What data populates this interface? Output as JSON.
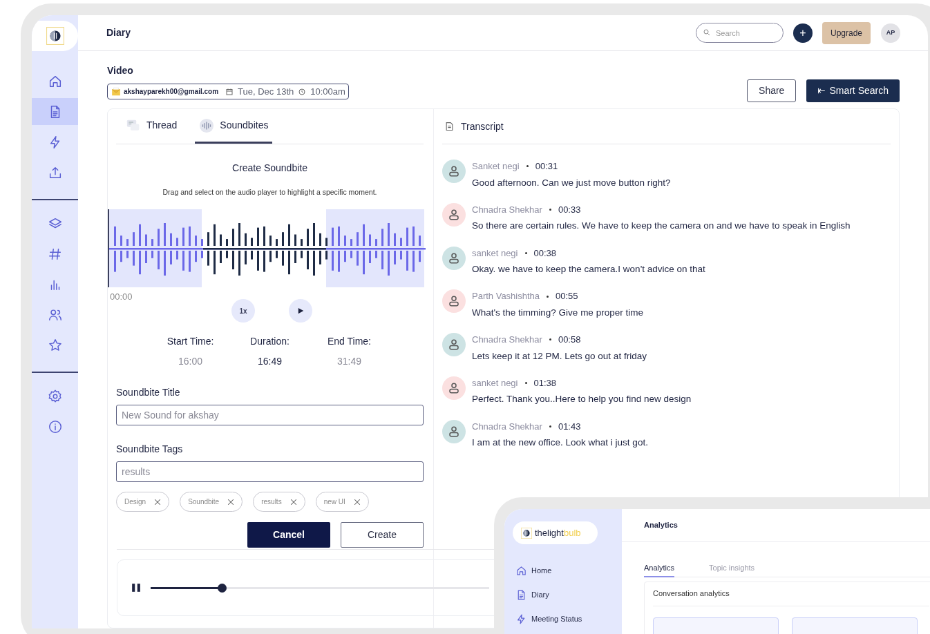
{
  "header": {
    "title": "Diary",
    "search": {
      "placeholder": "Search"
    },
    "add_button": "+",
    "upgrade_button": "Upgrade",
    "avatar": "AP"
  },
  "sidebar": {
    "groups": [
      [
        {
          "kind": "home",
          "selected": false
        },
        {
          "kind": "document",
          "selected": true
        },
        {
          "kind": "bolt",
          "selected": false
        },
        {
          "kind": "upload",
          "selected": false
        }
      ],
      [
        {
          "kind": "layers",
          "selected": false
        },
        {
          "kind": "hash",
          "selected": false
        },
        {
          "kind": "chart",
          "selected": false
        },
        {
          "kind": "users",
          "selected": false
        },
        {
          "kind": "star",
          "selected": false
        }
      ],
      [
        {
          "kind": "settings",
          "selected": false
        },
        {
          "kind": "info",
          "selected": false
        }
      ]
    ]
  },
  "video": {
    "title": "Video",
    "email": "akshayparekh00@gmail.com",
    "date": "Tue, Dec 13th",
    "time": "10:00am",
    "actions": [
      {
        "label": "Share",
        "kind": "outline"
      },
      {
        "label": "Smart Search",
        "kind": "primary"
      }
    ]
  },
  "tabs": [
    {
      "label": "Thread",
      "kind": "thread",
      "selected": false
    },
    {
      "label": "Soundbites",
      "kind": "sound",
      "selected": true
    }
  ],
  "soundbite": {
    "title": "Create Soundbite",
    "hint": "Drag and select on the audio player to highlight a specific moment.",
    "time": "00:00",
    "speed": "1x",
    "stats": [
      {
        "label": "Start Time:",
        "value": "16:00",
        "kind": "muted"
      },
      {
        "label": "Duration:",
        "value": "16:49",
        "kind": "strong"
      },
      {
        "label": "End Time:",
        "value": "31:49",
        "kind": "muted"
      }
    ],
    "title_label": "Soundbite Title",
    "title_placeholder": "New Sound for akshay",
    "tags_label": "Soundbite Tags",
    "tags_placeholder": "results",
    "tags": [
      "Design",
      "Soundbite",
      "results",
      "new UI"
    ],
    "buttons": [
      {
        "label": "Cancel",
        "kind": "primary"
      },
      {
        "label": "Create",
        "kind": "outline"
      }
    ]
  },
  "player": {
    "level": 0.21
  },
  "transcript": {
    "title": "Transcript",
    "entries": [
      {
        "speaker": "Sanket negi",
        "time": "00:31",
        "text": "Good afternoon. Can we just move button right?",
        "color": "#cde3e4"
      },
      {
        "speaker": "Chnadra Shekhar",
        "time": "00:33",
        "text": "So there are certain rules. We have to keep the camera on and we have to speak in English",
        "color": "#fbe0e0"
      },
      {
        "speaker": "sanket negi",
        "time": "00:38",
        "text": "Okay. we have to keep the camera.I won't advice on that",
        "color": "#cde3e4"
      },
      {
        "speaker": "Parth Vashishtha",
        "time": "00:55",
        "text": "What's the timming? Give me proper time",
        "color": "#fbe0e0"
      },
      {
        "speaker": "Chnadra Shekhar",
        "time": "00:58",
        "text": "Lets keep it at 12 PM. Lets go out at friday",
        "color": "#cde3e4"
      },
      {
        "speaker": "sanket negi",
        "time": "01:38",
        "text": "Perfect. Thank you..Here to help you find new design",
        "color": "#fbe0e0"
      },
      {
        "speaker": "Chnadra Shekhar",
        "time": "01:43",
        "text": "I am at the new office. Look what i just got.",
        "color": "#cde3e4"
      }
    ]
  },
  "analytics_window": {
    "brand": "thelight",
    "brand_accent": "bulb",
    "nav": [
      {
        "label": "Home",
        "kind": "home"
      },
      {
        "label": "Diary",
        "kind": "document"
      },
      {
        "label": "Meeting Status",
        "kind": "bolt"
      }
    ],
    "title": "Analytics",
    "tabs": [
      {
        "label": "Analytics",
        "selected": true
      },
      {
        "label": "Topic insights",
        "selected": false
      }
    ],
    "card_title": "Conversation analytics"
  }
}
